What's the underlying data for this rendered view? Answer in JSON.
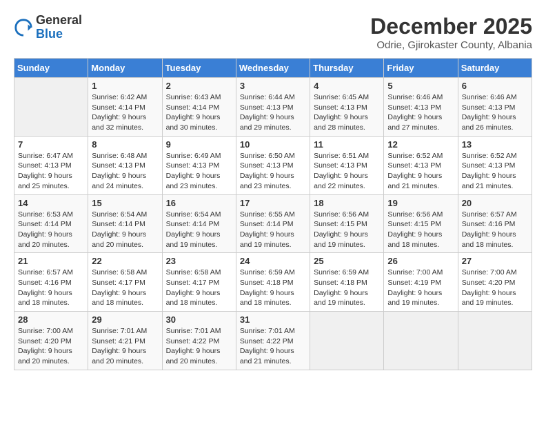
{
  "logo": {
    "general": "General",
    "blue": "Blue"
  },
  "title": "December 2025",
  "subtitle": "Odrie, Gjirokaster County, Albania",
  "weekdays": [
    "Sunday",
    "Monday",
    "Tuesday",
    "Wednesday",
    "Thursday",
    "Friday",
    "Saturday"
  ],
  "weeks": [
    [
      {
        "day": "",
        "empty": true
      },
      {
        "day": "1",
        "sunrise": "Sunrise: 6:42 AM",
        "sunset": "Sunset: 4:14 PM",
        "daylight": "Daylight: 9 hours and 32 minutes."
      },
      {
        "day": "2",
        "sunrise": "Sunrise: 6:43 AM",
        "sunset": "Sunset: 4:14 PM",
        "daylight": "Daylight: 9 hours and 30 minutes."
      },
      {
        "day": "3",
        "sunrise": "Sunrise: 6:44 AM",
        "sunset": "Sunset: 4:13 PM",
        "daylight": "Daylight: 9 hours and 29 minutes."
      },
      {
        "day": "4",
        "sunrise": "Sunrise: 6:45 AM",
        "sunset": "Sunset: 4:13 PM",
        "daylight": "Daylight: 9 hours and 28 minutes."
      },
      {
        "day": "5",
        "sunrise": "Sunrise: 6:46 AM",
        "sunset": "Sunset: 4:13 PM",
        "daylight": "Daylight: 9 hours and 27 minutes."
      },
      {
        "day": "6",
        "sunrise": "Sunrise: 6:46 AM",
        "sunset": "Sunset: 4:13 PM",
        "daylight": "Daylight: 9 hours and 26 minutes."
      }
    ],
    [
      {
        "day": "7",
        "sunrise": "Sunrise: 6:47 AM",
        "sunset": "Sunset: 4:13 PM",
        "daylight": "Daylight: 9 hours and 25 minutes."
      },
      {
        "day": "8",
        "sunrise": "Sunrise: 6:48 AM",
        "sunset": "Sunset: 4:13 PM",
        "daylight": "Daylight: 9 hours and 24 minutes."
      },
      {
        "day": "9",
        "sunrise": "Sunrise: 6:49 AM",
        "sunset": "Sunset: 4:13 PM",
        "daylight": "Daylight: 9 hours and 23 minutes."
      },
      {
        "day": "10",
        "sunrise": "Sunrise: 6:50 AM",
        "sunset": "Sunset: 4:13 PM",
        "daylight": "Daylight: 9 hours and 23 minutes."
      },
      {
        "day": "11",
        "sunrise": "Sunrise: 6:51 AM",
        "sunset": "Sunset: 4:13 PM",
        "daylight": "Daylight: 9 hours and 22 minutes."
      },
      {
        "day": "12",
        "sunrise": "Sunrise: 6:52 AM",
        "sunset": "Sunset: 4:13 PM",
        "daylight": "Daylight: 9 hours and 21 minutes."
      },
      {
        "day": "13",
        "sunrise": "Sunrise: 6:52 AM",
        "sunset": "Sunset: 4:13 PM",
        "daylight": "Daylight: 9 hours and 21 minutes."
      }
    ],
    [
      {
        "day": "14",
        "sunrise": "Sunrise: 6:53 AM",
        "sunset": "Sunset: 4:14 PM",
        "daylight": "Daylight: 9 hours and 20 minutes."
      },
      {
        "day": "15",
        "sunrise": "Sunrise: 6:54 AM",
        "sunset": "Sunset: 4:14 PM",
        "daylight": "Daylight: 9 hours and 20 minutes."
      },
      {
        "day": "16",
        "sunrise": "Sunrise: 6:54 AM",
        "sunset": "Sunset: 4:14 PM",
        "daylight": "Daylight: 9 hours and 19 minutes."
      },
      {
        "day": "17",
        "sunrise": "Sunrise: 6:55 AM",
        "sunset": "Sunset: 4:14 PM",
        "daylight": "Daylight: 9 hours and 19 minutes."
      },
      {
        "day": "18",
        "sunrise": "Sunrise: 6:56 AM",
        "sunset": "Sunset: 4:15 PM",
        "daylight": "Daylight: 9 hours and 19 minutes."
      },
      {
        "day": "19",
        "sunrise": "Sunrise: 6:56 AM",
        "sunset": "Sunset: 4:15 PM",
        "daylight": "Daylight: 9 hours and 18 minutes."
      },
      {
        "day": "20",
        "sunrise": "Sunrise: 6:57 AM",
        "sunset": "Sunset: 4:16 PM",
        "daylight": "Daylight: 9 hours and 18 minutes."
      }
    ],
    [
      {
        "day": "21",
        "sunrise": "Sunrise: 6:57 AM",
        "sunset": "Sunset: 4:16 PM",
        "daylight": "Daylight: 9 hours and 18 minutes."
      },
      {
        "day": "22",
        "sunrise": "Sunrise: 6:58 AM",
        "sunset": "Sunset: 4:17 PM",
        "daylight": "Daylight: 9 hours and 18 minutes."
      },
      {
        "day": "23",
        "sunrise": "Sunrise: 6:58 AM",
        "sunset": "Sunset: 4:17 PM",
        "daylight": "Daylight: 9 hours and 18 minutes."
      },
      {
        "day": "24",
        "sunrise": "Sunrise: 6:59 AM",
        "sunset": "Sunset: 4:18 PM",
        "daylight": "Daylight: 9 hours and 18 minutes."
      },
      {
        "day": "25",
        "sunrise": "Sunrise: 6:59 AM",
        "sunset": "Sunset: 4:18 PM",
        "daylight": "Daylight: 9 hours and 19 minutes."
      },
      {
        "day": "26",
        "sunrise": "Sunrise: 7:00 AM",
        "sunset": "Sunset: 4:19 PM",
        "daylight": "Daylight: 9 hours and 19 minutes."
      },
      {
        "day": "27",
        "sunrise": "Sunrise: 7:00 AM",
        "sunset": "Sunset: 4:20 PM",
        "daylight": "Daylight: 9 hours and 19 minutes."
      }
    ],
    [
      {
        "day": "28",
        "sunrise": "Sunrise: 7:00 AM",
        "sunset": "Sunset: 4:20 PM",
        "daylight": "Daylight: 9 hours and 20 minutes."
      },
      {
        "day": "29",
        "sunrise": "Sunrise: 7:01 AM",
        "sunset": "Sunset: 4:21 PM",
        "daylight": "Daylight: 9 hours and 20 minutes."
      },
      {
        "day": "30",
        "sunrise": "Sunrise: 7:01 AM",
        "sunset": "Sunset: 4:22 PM",
        "daylight": "Daylight: 9 hours and 20 minutes."
      },
      {
        "day": "31",
        "sunrise": "Sunrise: 7:01 AM",
        "sunset": "Sunset: 4:22 PM",
        "daylight": "Daylight: 9 hours and 21 minutes."
      },
      {
        "day": "",
        "empty": true
      },
      {
        "day": "",
        "empty": true
      },
      {
        "day": "",
        "empty": true
      }
    ]
  ]
}
